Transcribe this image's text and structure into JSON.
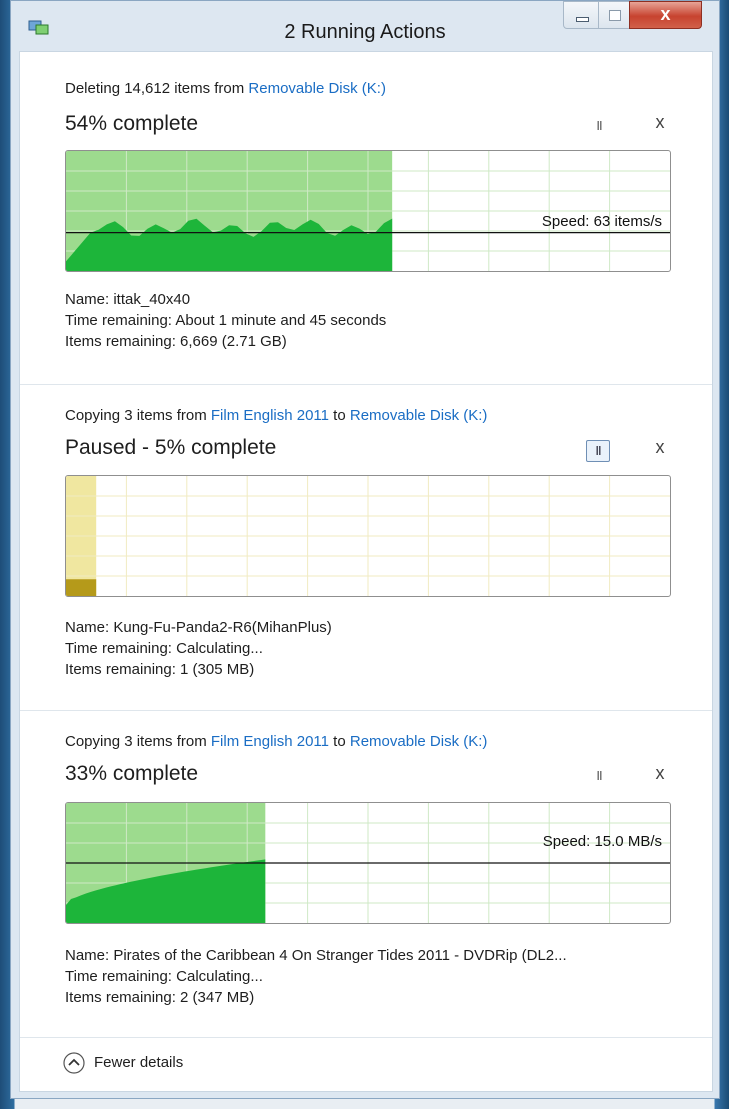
{
  "window": {
    "title": "2 Running Actions",
    "close_glyph": "x",
    "icon": "file-transfer-icon"
  },
  "operations": [
    {
      "headline_prefix": "Deleting 14,612 items from ",
      "source": "Removable Disk (K:)",
      "status": "54% complete",
      "progress": 0.54,
      "paused": false,
      "speed": "Speed: 63 items/s",
      "speed_level": 0.32,
      "name": "Name:  ittak_40x40",
      "time_remaining": "Time remaining:  About 1 minute and 45 seconds",
      "items_remaining": "Items remaining:  6,669 (2.71 GB)",
      "pause_glyph": "II",
      "cancel_glyph": "x",
      "theme": "green"
    },
    {
      "headline_prefix": "Copying 3 items from ",
      "source": "Film English 2011",
      "headline_mid": " to ",
      "destination": "Removable Disk (K:)",
      "status": "Paused - 5% complete",
      "progress": 0.05,
      "paused": true,
      "name": "Name:  Kung-Fu-Panda2-R6(MihanPlus)",
      "time_remaining": "Time remaining:  Calculating...",
      "items_remaining": "Items remaining:  1 (305 MB)",
      "pause_glyph": "II",
      "cancel_glyph": "x",
      "theme": "yellow"
    },
    {
      "headline_prefix": "Copying 3 items from ",
      "source": "Film English 2011",
      "headline_mid": " to ",
      "destination": "Removable Disk (K:)",
      "status": "33% complete",
      "progress": 0.33,
      "paused": false,
      "speed": "Speed: 15.0 MB/s",
      "speed_level": 0.5,
      "name": "Name:  Pirates of the Caribbean 4 On Stranger Tides 2011 - DVDRip (DL2...",
      "time_remaining": "Time remaining:  Calculating...",
      "items_remaining": "Items remaining:  2 (347 MB)",
      "pause_glyph": "II",
      "cancel_glyph": "x",
      "theme": "green"
    }
  ],
  "footer": {
    "label": "Fewer details",
    "icon": "chevron-up-icon"
  },
  "colors": {
    "link": "#1a6dc4",
    "green_light": "#9ddb8e",
    "green_dark": "#1db53a",
    "yellow_light": "#f0e7a0",
    "yellow_dark": "#b59a1a"
  }
}
